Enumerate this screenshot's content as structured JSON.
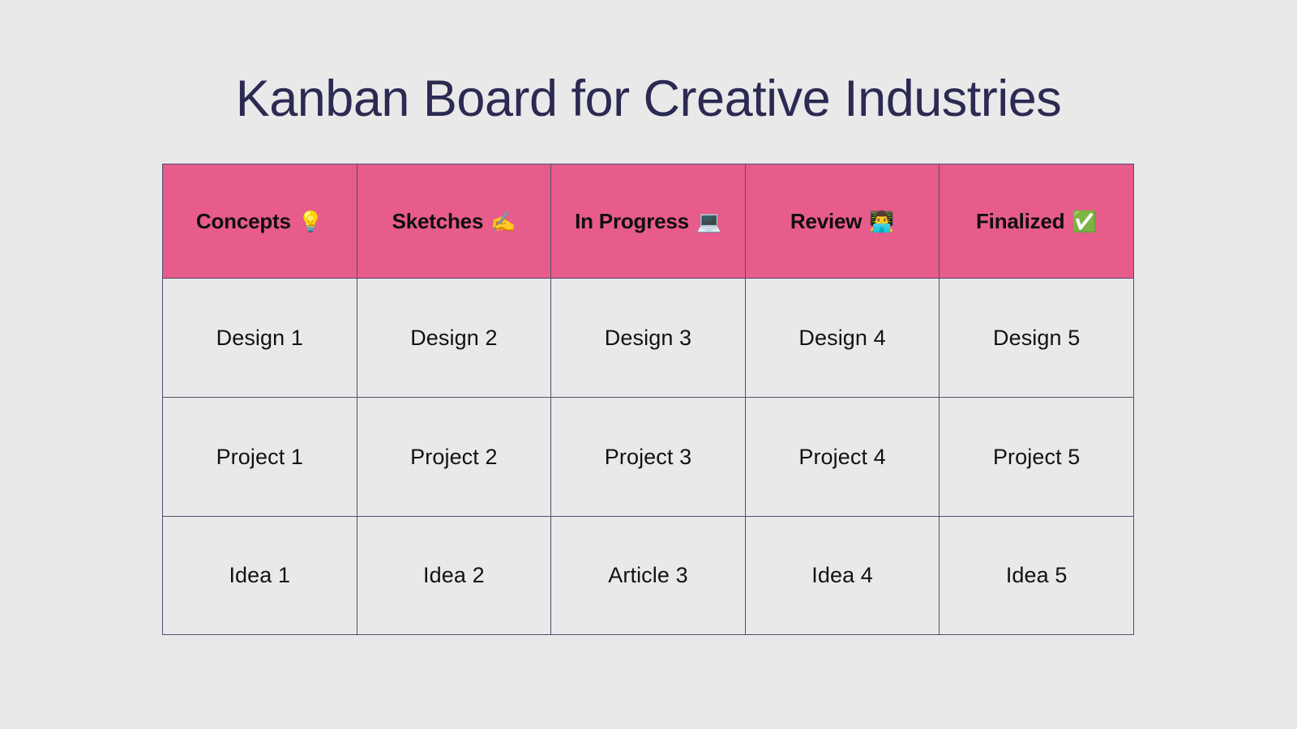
{
  "page": {
    "title": "Kanban Board for Creative Industries",
    "background_color": "#eae9e9",
    "title_color": "#2b2a52"
  },
  "board": {
    "header_background_color": "#e75c8b",
    "cell_background_color": "#eae9e9",
    "border_color": "#4f4f6b",
    "columns": [
      {
        "label": "Concepts",
        "emoji": "💡",
        "icon_name": "lightbulb-emoji"
      },
      {
        "label": "Sketches",
        "emoji": "✍️",
        "icon_name": "writing-hand-emoji"
      },
      {
        "label": "In Progress",
        "emoji": "💻",
        "icon_name": "laptop-emoji"
      },
      {
        "label": "Review",
        "emoji": "👨‍💻",
        "icon_name": "technologist-emoji"
      },
      {
        "label": "Finalized",
        "emoji": "✅",
        "icon_name": "check-mark-button-emoji"
      }
    ],
    "rows": [
      [
        "Design 1",
        "Design 2",
        "Design 3",
        "Design 4",
        "Design 5"
      ],
      [
        "Project 1",
        "Project 2",
        "Project 3",
        "Project 4",
        "Project 5"
      ],
      [
        "Idea 1",
        "Idea 2",
        "Article 3",
        "Idea 4",
        "Idea 5"
      ]
    ]
  }
}
